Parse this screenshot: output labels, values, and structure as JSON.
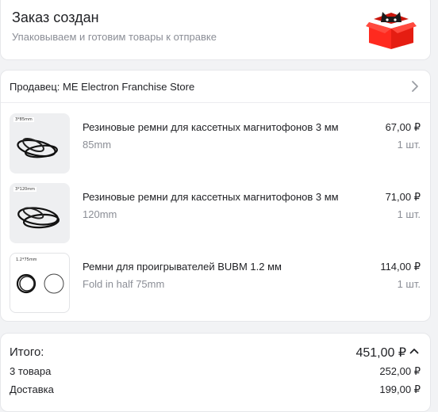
{
  "status": {
    "title": "Заказ создан",
    "subtitle": "Упаковываем и готовим товары к отправке",
    "illustration_icon": "red-box-with-cat-icon"
  },
  "seller": {
    "label": "Продавец: ME Electron Franchise Store"
  },
  "items": [
    {
      "name": "Резиновые ремни для кассетных магнитофонов 3 мм",
      "variant": "85mm",
      "price": "67,00 ₽",
      "qty": "1 шт.",
      "thumb_label": "3*85mm"
    },
    {
      "name": "Резиновые ремни для кассетных магнитофонов 3 мм",
      "variant": "120mm",
      "price": "71,00 ₽",
      "qty": "1 шт.",
      "thumb_label": "3*120mm"
    },
    {
      "name": "Ремни для проигрывателей BUBM 1.2 мм",
      "variant": "Fold in half 75mm",
      "price": "114,00 ₽",
      "qty": "1 шт.",
      "thumb_label": "1.2*75mm"
    }
  ],
  "totals": {
    "total_label": "Итого:",
    "total_value": "451,00 ₽",
    "goods_label": "3 товара",
    "goods_value": "252,00 ₽",
    "delivery_label": "Доставка",
    "delivery_value": "199,00 ₽"
  },
  "colors": {
    "background": "#f2f3f5",
    "card": "#ffffff",
    "text": "#1f2024",
    "muted": "#8b8e96",
    "box_red": "#ff2a1f"
  }
}
